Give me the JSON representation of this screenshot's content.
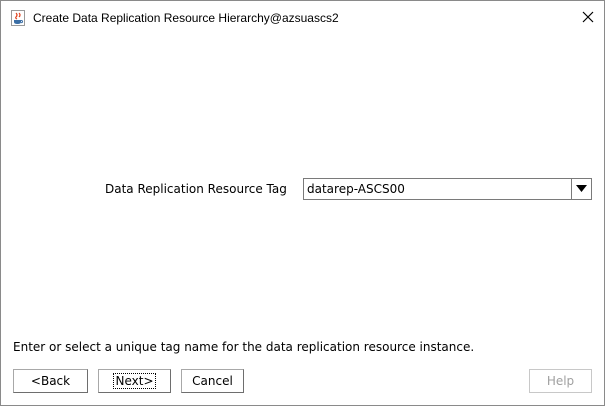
{
  "window": {
    "title": "Create Data Replication Resource Hierarchy@azsuascs2",
    "app_icon": "java-cup-icon",
    "close_icon": "close-icon"
  },
  "form": {
    "tag_label": "Data Replication Resource Tag",
    "tag_value": "datarep-ASCS00",
    "dropdown_icon": "chevron-down-icon"
  },
  "help_text": "Enter or select a unique tag name for the data replication resource instance.",
  "buttons": {
    "back": "<Back",
    "next": "Next>",
    "cancel": "Cancel",
    "help": "Help"
  }
}
